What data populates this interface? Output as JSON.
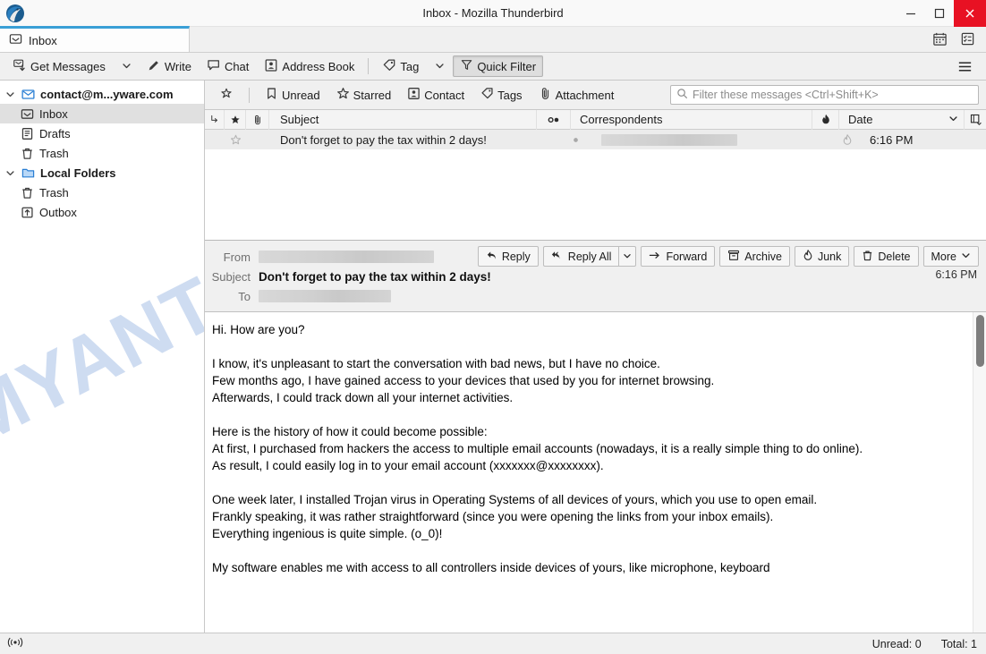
{
  "window": {
    "title": "Inbox - Mozilla Thunderbird",
    "minimize_label": "Minimize",
    "maximize_label": "Maximize",
    "close_label": "Close"
  },
  "watermark": {
    "text": "MYANTISPYWARE.COM",
    "color": "#5e8cd0"
  },
  "tabs": {
    "items": [
      {
        "label": "Inbox",
        "icon": "inbox-icon",
        "active": true
      }
    ],
    "right_icons": [
      {
        "name": "calendar-icon",
        "label": "Calendar"
      },
      {
        "name": "tasks-icon",
        "label": "Tasks"
      }
    ]
  },
  "toolbar": {
    "get_messages": "Get Messages",
    "write": "Write",
    "chat": "Chat",
    "address_book": "Address Book",
    "tag": "Tag",
    "quick_filter": "Quick Filter",
    "quick_filter_active": true,
    "menu": "App Menu"
  },
  "folder_pane": {
    "rows": [
      {
        "label": "contact@m...ywarе.com",
        "display": "contact@m...yware.com",
        "icon": "mail-account-icon",
        "level": 0,
        "bold": true,
        "twisty": true,
        "selected": false
      },
      {
        "label": "Inbox",
        "icon": "inbox-icon",
        "level": 1,
        "bold": false,
        "twisty": false,
        "selected": true
      },
      {
        "label": "Drafts",
        "icon": "drafts-icon",
        "level": 1,
        "bold": false,
        "twisty": false,
        "selected": false
      },
      {
        "label": "Trash",
        "icon": "trash-icon",
        "level": 1,
        "bold": false,
        "twisty": false,
        "selected": false
      },
      {
        "label": "Local Folders",
        "icon": "folder-icon",
        "level": 0,
        "bold": true,
        "twisty": true,
        "selected": false
      },
      {
        "label": "Trash",
        "icon": "trash-icon",
        "level": 1,
        "bold": false,
        "twisty": false,
        "selected": false
      },
      {
        "label": "Outbox",
        "icon": "outbox-icon",
        "level": 1,
        "bold": false,
        "twisty": false,
        "selected": false
      }
    ]
  },
  "quick_filter": {
    "buttons": [
      {
        "label": "Unread",
        "icon": "unread-icon"
      },
      {
        "label": "Starred",
        "icon": "star-icon"
      },
      {
        "label": "Contact",
        "icon": "contact-icon"
      },
      {
        "label": "Tags",
        "icon": "tag-icon"
      },
      {
        "label": "Attachment",
        "icon": "attachment-icon"
      }
    ],
    "pin_icon": "pin-star-icon",
    "search_placeholder": "Filter these messages <Ctrl+Shift+K>",
    "search_value": ""
  },
  "message_list": {
    "columns": [
      {
        "key": "thread",
        "label": "",
        "icon": "thread-icon"
      },
      {
        "key": "star",
        "label": "",
        "icon": "star-icon"
      },
      {
        "key": "attachment",
        "label": "",
        "icon": "attachment-icon"
      },
      {
        "key": "subject",
        "label": "Subject"
      },
      {
        "key": "unread",
        "label": "",
        "icon": "unread-dot-icon"
      },
      {
        "key": "correspondents",
        "label": "Correspondents"
      },
      {
        "key": "junk",
        "label": "",
        "icon": "junk-icon"
      },
      {
        "key": "date",
        "label": "Date",
        "sorted": true,
        "sort_dir": "desc"
      },
      {
        "key": "picker",
        "label": "",
        "icon": "column-picker-icon"
      }
    ],
    "rows": [
      {
        "subject": "Don't forget to pay the tax within 2 days!",
        "correspondents": "",
        "correspondents_redacted": true,
        "date": "6:16 PM",
        "starred": false,
        "selected": true
      }
    ]
  },
  "message_header": {
    "from_label": "From",
    "from_value": "",
    "from_redacted": true,
    "subject_label": "Subject",
    "subject_value": "Don't forget to pay the tax within 2 days!",
    "to_label": "To",
    "to_value": "",
    "to_redacted": true,
    "date": "6:16 PM",
    "actions": [
      {
        "label": "Reply",
        "icon": "reply-icon",
        "split": false
      },
      {
        "label": "Reply All",
        "icon": "reply-all-icon",
        "split": true
      },
      {
        "label": "Forward",
        "icon": "forward-icon",
        "split": false
      },
      {
        "label": "Archive",
        "icon": "archive-icon",
        "split": false
      },
      {
        "label": "Junk",
        "icon": "junk-icon",
        "split": false
      },
      {
        "label": "Delete",
        "icon": "trash-icon",
        "split": false
      },
      {
        "label": "More",
        "icon": "chevron-down-icon",
        "split": false
      }
    ]
  },
  "message_body": {
    "paragraphs": [
      "Hi. How are you?",
      "I know, it's unpleasant to start the conversation with bad news, but I have no choice.\nFew months ago, I have gained access to your devices that used by you for internet browsing.\nAfterwards, I could track down all your internet activities.",
      "Here is the history of how it could become possible:\nAt first, I purchased from hackers the access to multiple email accounts (nowadays, it is a really simple thing to do online).\nAs result, I could easily log in to your email account (xxxxxxx@xxxxxxxx).",
      "One week later, I installed Trojan virus in Operating Systems of all devices of yours, which you use to open email.\nFrankly speaking, it was rather straightforward (since you were opening the links from your inbox emails).\nEverything ingenious is quite simple. (o_0)!",
      "My software enables me with access to all controllers inside devices of yours, like microphone, keyboard"
    ]
  },
  "status_bar": {
    "network_icon": "network-activity-icon",
    "unread": "Unread: 0",
    "total": "Total: 1"
  }
}
